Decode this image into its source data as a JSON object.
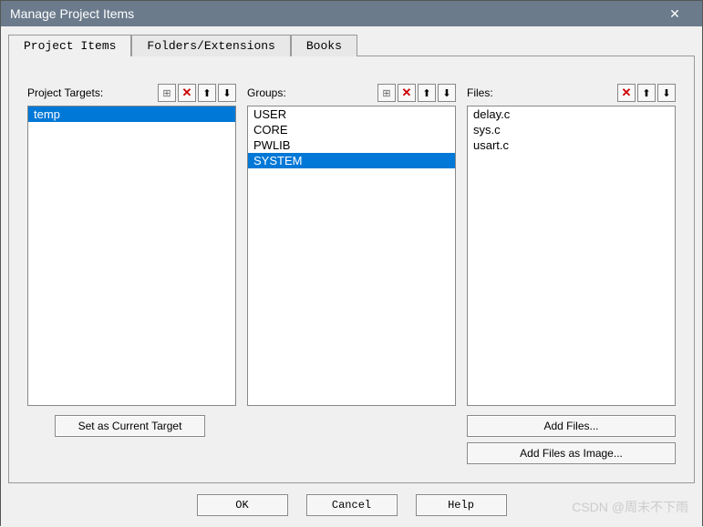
{
  "titlebar": {
    "title": "Manage Project Items"
  },
  "tabs": {
    "items": [
      {
        "label": "Project Items"
      },
      {
        "label": "Folders/Extensions"
      },
      {
        "label": "Books"
      }
    ]
  },
  "columns": {
    "targets": {
      "label": "Project Targets:",
      "items": [
        "temp"
      ],
      "selected": 0
    },
    "groups": {
      "label": "Groups:",
      "items": [
        "USER",
        "CORE",
        "PWLIB",
        "SYSTEM"
      ],
      "selected": 3
    },
    "files": {
      "label": "Files:",
      "items": [
        "delay.c",
        "sys.c",
        "usart.c"
      ],
      "selected": -1
    }
  },
  "buttons": {
    "set_current_target": "Set as Current Target",
    "add_files": "Add Files...",
    "add_files_image": "Add Files as Image...",
    "ok": "OK",
    "cancel": "Cancel",
    "help": "Help"
  },
  "icons": {
    "new": "⊞",
    "del": "✕",
    "up": "⬆",
    "down": "⬇",
    "close": "✕"
  },
  "watermark": "CSDN @周末不下雨"
}
